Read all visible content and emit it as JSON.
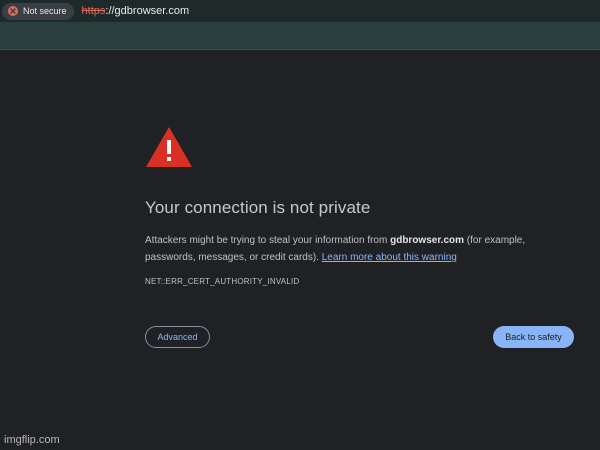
{
  "address_bar": {
    "security_label": "Not secure",
    "security_icon": "not-secure-icon",
    "url_scheme": "https",
    "url_rest": "://gdbrowser.com"
  },
  "interstitial": {
    "warning_icon": "warning-triangle-icon",
    "title": "Your connection is not private",
    "description_before": "Attackers might be trying to steal your information from ",
    "domain": "gdbrowser.com",
    "description_after": " (for example, passwords, messages, or credit cards). ",
    "learn_more_link": "Learn more about this warning",
    "error_code": "NET::ERR_CERT_AUTHORITY_INVALID",
    "advanced_button": "Advanced",
    "back_button": "Back to safety"
  },
  "watermark": "imgflip.com",
  "colors": {
    "background": "#202124",
    "warning_red": "#d93025",
    "link_blue": "#8ab4f8",
    "insecure_scheme": "#e06a5e"
  }
}
